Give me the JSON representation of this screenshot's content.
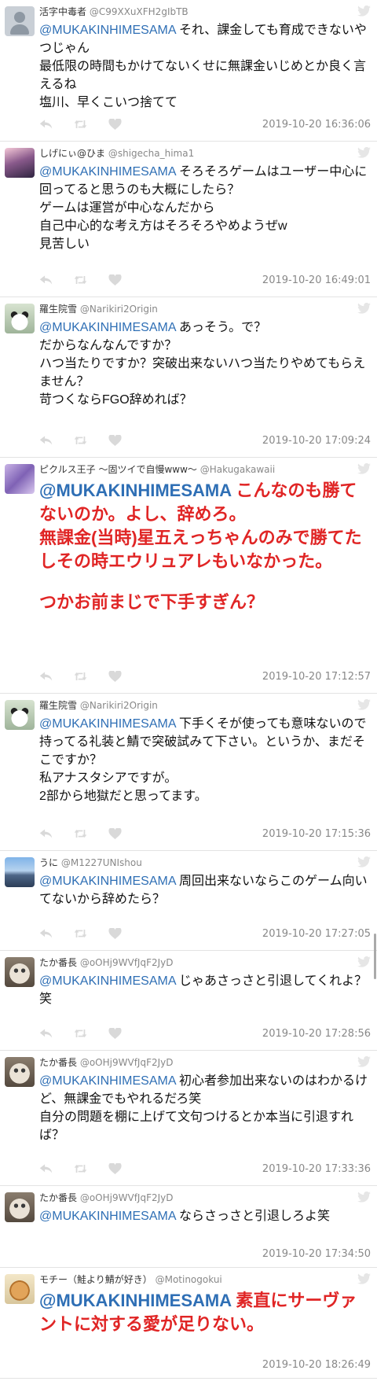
{
  "tweets": [
    {
      "name": "活字中毒者",
      "handle": "@C99XXuXFH2gIbTB",
      "mention": "@MUKAKINHIMESAMA",
      "text": " それ、課金しても育成できないやつじゃん\n最低限の時間もかけてないくせに無課金いじめとか良く言えるね\n塩川、早くこいつ捨てて",
      "time": "2019-10-20 16:36:06"
    },
    {
      "name": "しげにぃ@ひま",
      "handle": "@shigecha_hima1",
      "mention": "@MUKAKINHIMESAMA",
      "text": " そろそろゲームはユーザー中心に回ってると思うのも大概にしたら？\nゲームは運営が中心なんだから\n自己中心的な考え方はそろそろやめようぜw\n見苦しい",
      "time": "2019-10-20 16:49:01"
    },
    {
      "name": "羅生院雪",
      "handle": "@Narikiri2Origin",
      "mention": "@MUKAKINHIMESAMA",
      "text": " あっそう。で？\nだからなんなんですか？\nハつ当たりですか？突破出来ないハつ当たりやめてもらえません？\n苛つくならFGO辞めれば？",
      "time": "2019-10-20 17:09:24"
    },
    {
      "name": "ピクルス王子 〜固ツイで自慢www〜",
      "handle": "@Hakugakawaii",
      "mention": "@MUKAKINHIMESAMA",
      "text": " こんなのも勝てないのか。よし、辞めろ。\n無課金(当時)星五えっちゃんのみで勝てたしその時エウリュアレもいなかった。",
      "extra": "つかお前まじで下手すぎん？",
      "time": "2019-10-20 17:12:57"
    },
    {
      "name": "羅生院雪",
      "handle": "@Narikiri2Origin",
      "mention": "@MUKAKINHIMESAMA",
      "text": " 下手くそが使っても意味ないので持ってる礼装と鯖で突破試みて下さい。というか、まだそこですか？\n私アナスタシアですが。\n2部から地獄だと思ってます。",
      "time": "2019-10-20 17:15:36"
    },
    {
      "name": "うに",
      "handle": "@M1227UNIshou",
      "mention": "@MUKAKINHIMESAMA",
      "text": " 周回出来ないならこのゲーム向いてないから辞めたら？",
      "time": "2019-10-20 17:27:05"
    },
    {
      "name": "たか番長",
      "handle": "@oOHj9WVfJqF2JyD",
      "mention": "@MUKAKINHIMESAMA",
      "text": " じゃあさっさと引退してくれよ？笑",
      "time": "2019-10-20 17:28:56"
    },
    {
      "name": "たか番長",
      "handle": "@oOHj9WVfJqF2JyD",
      "mention": "@MUKAKINHIMESAMA",
      "text": " 初心者参加出来ないのはわかるけど、無課金でもやれるだろ笑\n自分の問題を棚に上げて文句つけるとか本当に引退すれば？",
      "time": "2019-10-20 17:33:36"
    },
    {
      "name": "たか番長",
      "handle": "@oOHj9WVfJqF2JyD",
      "mention": "@MUKAKINHIMESAMA",
      "text": " ならさっさと引退しろよ笑",
      "time": "2019-10-20 17:34:50"
    },
    {
      "name": "モチー（鮭より鯖が好き）",
      "handle": "@Motinogokui",
      "mention": "@MUKAKINHIMESAMA",
      "text": " 素直にサーヴァントに対する愛が足りない。",
      "time": "2019-10-20 18:26:49"
    }
  ],
  "icons": {
    "reply": "reply-icon",
    "retweet": "retweet-icon",
    "like": "heart-icon",
    "platform": "twitter-bird-icon"
  },
  "colors": {
    "mention": "#2f6fb5",
    "emphasis": "#e02525",
    "meta": "#888888",
    "divider": "#e3e3e3"
  }
}
